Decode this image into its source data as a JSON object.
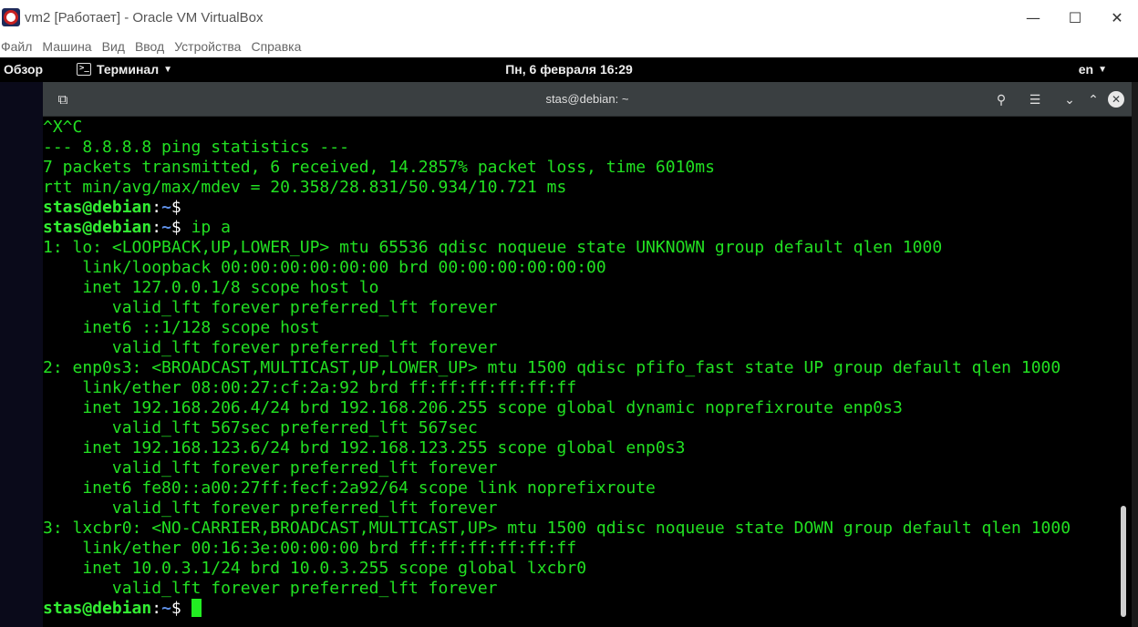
{
  "host": {
    "title": "vm2 [Работает] - Oracle VM VirtualBox",
    "controls": {
      "minimize": "—",
      "maximize": "☐",
      "close": "✕"
    },
    "menu": [
      "Файл",
      "Машина",
      "Вид",
      "Ввод",
      "Устройства",
      "Справка"
    ]
  },
  "guest_topbar": {
    "overview": "Обзор",
    "app_menu": "Терминал",
    "clock": "Пн, 6 февраля  16:29",
    "language": "en"
  },
  "terminal": {
    "title": "stas@debian: ~",
    "prompt": {
      "user_host": "stas@debian",
      "sep": ":",
      "path": "~",
      "dollar": "$"
    },
    "lines": [
      {
        "type": "out",
        "text": "^X^C"
      },
      {
        "type": "out",
        "text": "--- 8.8.8.8 ping statistics ---"
      },
      {
        "type": "out",
        "text": "7 packets transmitted, 6 received, 14.2857% packet loss, time 6010ms"
      },
      {
        "type": "out",
        "text": "rtt min/avg/max/mdev = 20.358/28.831/50.934/10.721 ms"
      },
      {
        "type": "prompt",
        "cmd": ""
      },
      {
        "type": "prompt",
        "cmd": " ip a"
      },
      {
        "type": "out",
        "text": "1: lo: <LOOPBACK,UP,LOWER_UP> mtu 65536 qdisc noqueue state UNKNOWN group default qlen 1000"
      },
      {
        "type": "out",
        "text": "    link/loopback 00:00:00:00:00:00 brd 00:00:00:00:00:00"
      },
      {
        "type": "out",
        "text": "    inet 127.0.0.1/8 scope host lo"
      },
      {
        "type": "out",
        "text": "       valid_lft forever preferred_lft forever"
      },
      {
        "type": "out",
        "text": "    inet6 ::1/128 scope host"
      },
      {
        "type": "out",
        "text": "       valid_lft forever preferred_lft forever"
      },
      {
        "type": "out",
        "text": "2: enp0s3: <BROADCAST,MULTICAST,UP,LOWER_UP> mtu 1500 qdisc pfifo_fast state UP group default qlen 1000"
      },
      {
        "type": "out",
        "text": "    link/ether 08:00:27:cf:2a:92 brd ff:ff:ff:ff:ff:ff"
      },
      {
        "type": "out",
        "text": "    inet 192.168.206.4/24 brd 192.168.206.255 scope global dynamic noprefixroute enp0s3"
      },
      {
        "type": "out",
        "text": "       valid_lft 567sec preferred_lft 567sec"
      },
      {
        "type": "out",
        "text": "    inet 192.168.123.6/24 brd 192.168.123.255 scope global enp0s3"
      },
      {
        "type": "out",
        "text": "       valid_lft forever preferred_lft forever"
      },
      {
        "type": "out",
        "text": "    inet6 fe80::a00:27ff:fecf:2a92/64 scope link noprefixroute"
      },
      {
        "type": "out",
        "text": "       valid_lft forever preferred_lft forever"
      },
      {
        "type": "out",
        "text": "3: lxcbr0: <NO-CARRIER,BROADCAST,MULTICAST,UP> mtu 1500 qdisc noqueue state DOWN group default qlen 1000"
      },
      {
        "type": "out",
        "text": "    link/ether 00:16:3e:00:00:00 brd ff:ff:ff:ff:ff:ff"
      },
      {
        "type": "out",
        "text": "    inet 10.0.3.1/24 brd 10.0.3.255 scope global lxcbr0"
      },
      {
        "type": "out",
        "text": "       valid_lft forever preferred_lft forever"
      },
      {
        "type": "prompt",
        "cmd": " ",
        "cursor": true
      }
    ]
  },
  "colors": {
    "terminal_fg": "#22e022",
    "prompt_user": "#33ee33",
    "prompt_path": "#5e8fe6",
    "header_bg": "#3a3f41"
  }
}
